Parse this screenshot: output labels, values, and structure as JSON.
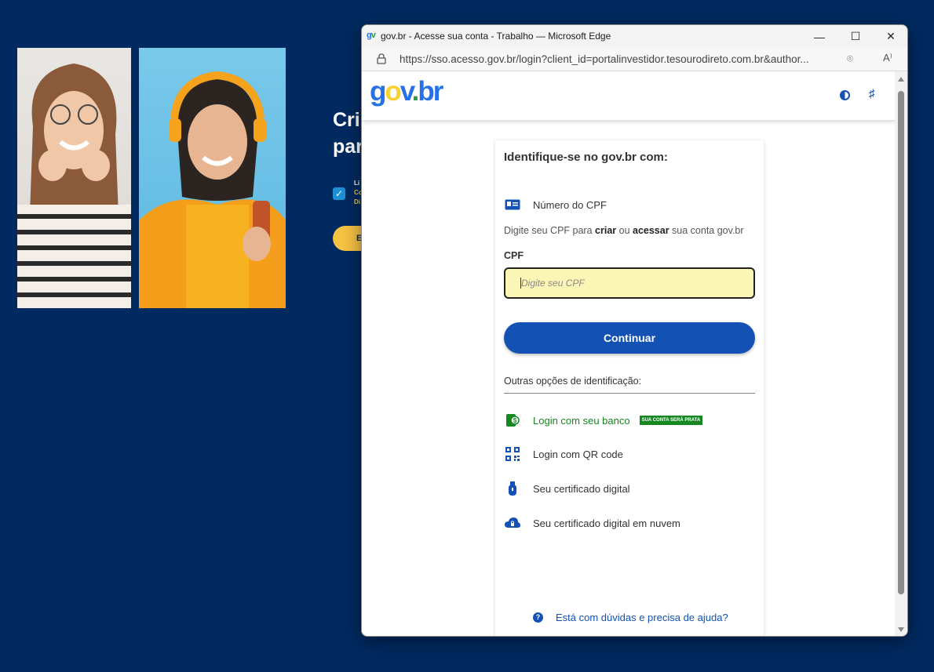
{
  "background": {
    "heading_line1": "Cri",
    "heading_line2": "par",
    "small_line1": "Li",
    "small_line2": "Co",
    "small_line3": "Di",
    "button_label": "E"
  },
  "window": {
    "title": "gov.br - Acesse sua conta - Trabalho — Microsoft Edge",
    "favicon_text": "gv",
    "url": "https://sso.acesso.gov.br/login?client_id=portalinvestidor.tesourodireto.com.br&author...",
    "minimize": "—",
    "maximize": "☐",
    "close": "✕",
    "location_icon": "⌾",
    "read_aloud_icon": "A⁾"
  },
  "header": {
    "logo_g": "g",
    "logo_o": "o",
    "logo_v": "v",
    "logo_dot": ".",
    "logo_b": "b",
    "logo_r": "r",
    "vlibras_icon": "♯"
  },
  "login": {
    "title": "Identifique-se no gov.br com:",
    "cpf_option": "Número do CPF",
    "hint_prefix": "Digite seu CPF para ",
    "hint_b1": "criar",
    "hint_mid": " ou ",
    "hint_b2": "acessar",
    "hint_suffix": " sua conta gov.br",
    "cpf_label": "CPF",
    "cpf_placeholder": "Digite seu CPF",
    "continue": "Continuar",
    "others_title": "Outras opções de identificação:",
    "options": [
      {
        "label": "Login com seu banco",
        "icon": "bank-icon"
      },
      {
        "label": "Login com QR code",
        "icon": "qr-code-icon"
      },
      {
        "label": "Seu certificado digital",
        "icon": "usb-token-icon"
      },
      {
        "label": "Seu certificado digital em nuvem",
        "icon": "cloud-certificate-icon"
      }
    ],
    "bank_badge": "SUA CONTA SERÁ PRATA",
    "help": "Está com dúvidas e precisa de ajuda?",
    "help_icon": "?"
  },
  "colors": {
    "page_background": "#002a60",
    "primary_blue": "#1351b4",
    "green": "#168821",
    "input_highlight": "#fbf6b5"
  }
}
